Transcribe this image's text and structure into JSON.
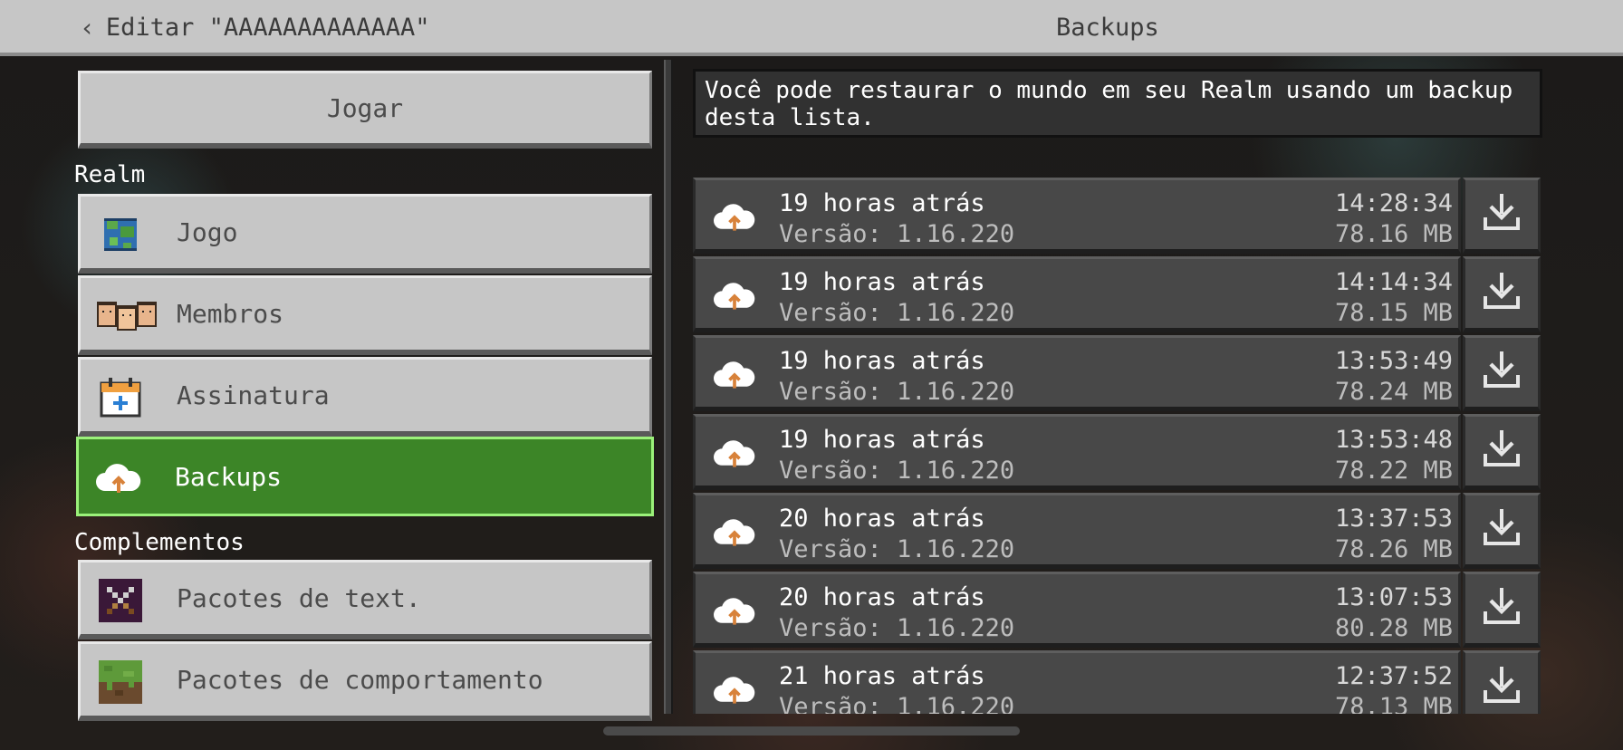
{
  "header": {
    "back_label": "Editar \"AAAAAAAAAAAAA\"",
    "title": "Backups"
  },
  "left": {
    "play_label": "Jogar",
    "realm_section": "Realm",
    "realm_items": [
      {
        "label": "Jogo",
        "icon": "globe-icon"
      },
      {
        "label": "Membros",
        "icon": "members-icon"
      },
      {
        "label": "Assinatura",
        "icon": "calendar-icon"
      },
      {
        "label": "Backups",
        "icon": "cloud-upload-icon",
        "active": true
      }
    ],
    "addons_section": "Complementos",
    "addon_items": [
      {
        "label": "Pacotes de text.",
        "icon": "sword-icon"
      },
      {
        "label": "Pacotes de comportamento",
        "icon": "grass-block-icon"
      }
    ]
  },
  "right": {
    "info_text": "Você pode restaurar o mundo em seu Realm usando um backup desta lista.",
    "backups": [
      {
        "when": "19 horas atrás",
        "version": "Versão: 1.16.220",
        "time": "14:28:34",
        "size": "78.16 MB"
      },
      {
        "when": "19 horas atrás",
        "version": "Versão: 1.16.220",
        "time": "14:14:34",
        "size": "78.15 MB"
      },
      {
        "when": "19 horas atrás",
        "version": "Versão: 1.16.220",
        "time": "13:53:49",
        "size": "78.24 MB"
      },
      {
        "when": "19 horas atrás",
        "version": "Versão: 1.16.220",
        "time": "13:53:48",
        "size": "78.22 MB"
      },
      {
        "when": "20 horas atrás",
        "version": "Versão: 1.16.220",
        "time": "13:37:53",
        "size": "78.26 MB"
      },
      {
        "when": "20 horas atrás",
        "version": "Versão: 1.16.220",
        "time": "13:07:53",
        "size": "80.28 MB"
      },
      {
        "when": "21 horas atrás",
        "version": "Versão: 1.16.220",
        "time": "12:37:52",
        "size": "78.13 MB"
      }
    ]
  },
  "colors": {
    "header_bg": "#c6c6c6",
    "button_bg": "#c6c6c6",
    "active_green": "#3c8527",
    "active_border": "#9bf17a",
    "row_bg": "#484848"
  }
}
